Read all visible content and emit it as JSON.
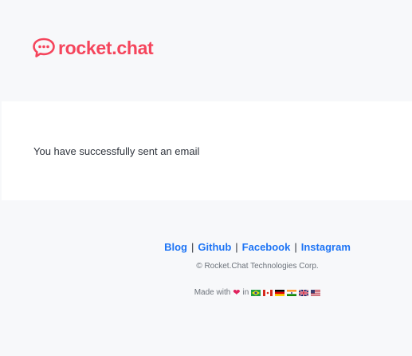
{
  "brand": {
    "name": "rocket.chat",
    "color": "#f5455c"
  },
  "message": "You have successfully sent an email",
  "footer": {
    "links": [
      "Blog",
      "Github",
      "Facebook",
      "Instagram"
    ],
    "separator": "|",
    "copyright": "© Rocket.Chat Technologies Corp.",
    "made_with": "Made with",
    "heart": "❤",
    "in": "in",
    "flags": [
      "brazil-flag",
      "canada-flag",
      "germany-flag",
      "india-flag",
      "uk-flag",
      "usa-flag"
    ]
  },
  "colors": {
    "link": "#1d74f5",
    "background": "#f7f8fa",
    "card": "#ffffff"
  }
}
